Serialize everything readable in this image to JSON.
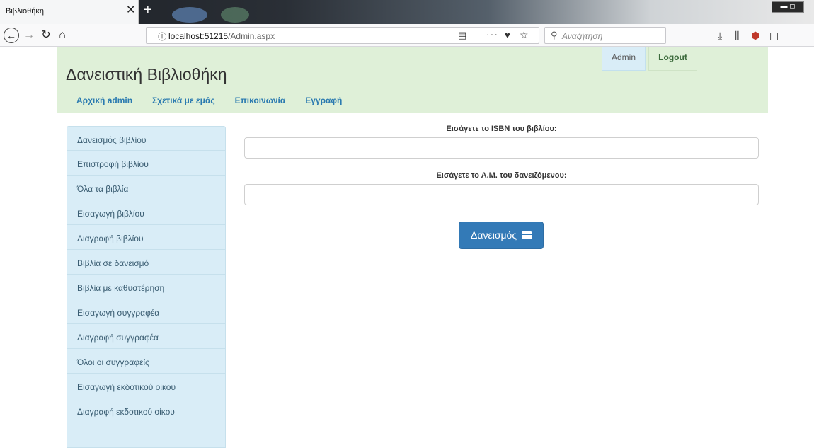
{
  "browser": {
    "tab_title": "Βιβλιοθήκη",
    "tab_close": "✕",
    "new_tab": "+",
    "url_host": "localhost:51215",
    "url_path": "/Admin.aspx",
    "search_placeholder": "Αναζήτηση",
    "icons": [
      "back-icon",
      "forward-icon",
      "reload-icon",
      "home-icon",
      "info-icon",
      "reader-view-icon",
      "page-actions-icon",
      "pocket-icon",
      "bookmark-star-icon",
      "search-icon",
      "downloads-icon",
      "library-icon",
      "ublock-icon",
      "sidebar-icon"
    ]
  },
  "header": {
    "brand": "Δανειστική Βιβλιοθήκη",
    "user": "Admin",
    "logout": "Logout",
    "nav": [
      {
        "label": "Αρχική admin"
      },
      {
        "label": "Σχετικά με εμάς"
      },
      {
        "label": "Επικοινωνία"
      },
      {
        "label": "Εγγραφή"
      }
    ]
  },
  "sidebar": {
    "items": [
      {
        "label": "Δανεισμός βιβλίου"
      },
      {
        "label": "Επιστροφή βιβλίου"
      },
      {
        "label": "Όλα τα βιβλία"
      },
      {
        "label": "Εισαγωγή βιβλίου"
      },
      {
        "label": "Διαγραφή βιβλίου"
      },
      {
        "label": "Βιβλία σε δανεισμό"
      },
      {
        "label": "Βιβλία με καθυστέρηση"
      },
      {
        "label": "Εισαγωγή συγγραφέα"
      },
      {
        "label": "Διαγραφή συγγραφέα"
      },
      {
        "label": "Όλοι οι συγγραφείς"
      },
      {
        "label": "Εισαγωγή εκδοτικού οίκου"
      },
      {
        "label": "Διαγραφή εκδοτικού οίκου"
      },
      {
        "label": ""
      }
    ]
  },
  "form": {
    "isbn_label": "Εισάγετε το ISBN του βιβλίου:",
    "isbn_value": "",
    "am_label": "Εισάγετε το Α.Μ. του δανειζόμενου:",
    "am_value": "",
    "submit_label": "Δανεισμός"
  },
  "colors": {
    "header_bg": "#dff0d8",
    "sidebar_bg": "#d9edf7",
    "nav_link": "#2a7ab0",
    "primary": "#337ab7"
  }
}
